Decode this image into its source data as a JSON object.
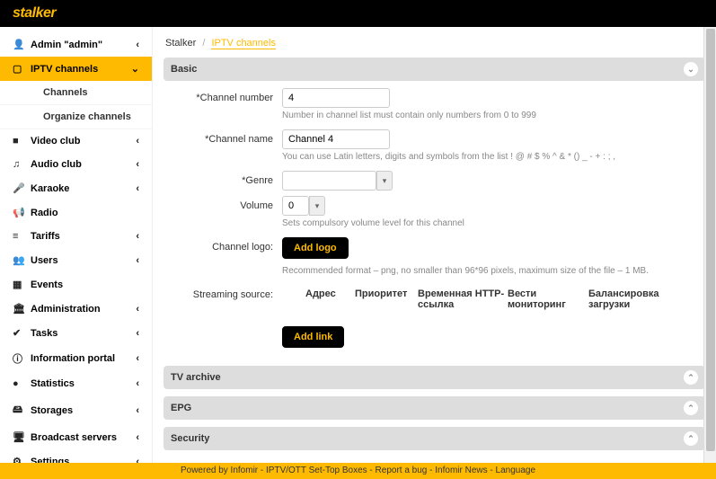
{
  "logo": "stalker",
  "breadcrumb": {
    "root": "Stalker",
    "current": "IPTV channels"
  },
  "sidebar": [
    {
      "icon": "👤",
      "label": "Admin \"admin\"",
      "chev": "‹",
      "self": true
    },
    {
      "icon": "▢",
      "label": "IPTV channels",
      "chev": "⌄",
      "active": true,
      "children": [
        {
          "label": "Channels"
        },
        {
          "label": "Organize channels"
        }
      ]
    },
    {
      "icon": "■",
      "label": "Video club",
      "chev": "‹"
    },
    {
      "icon": "♫",
      "label": "Audio club",
      "chev": "‹"
    },
    {
      "icon": "🎤",
      "label": "Karaoke",
      "chev": "‹"
    },
    {
      "icon": "📢",
      "label": "Radio",
      "chev": ""
    },
    {
      "icon": "≡",
      "label": "Tariffs",
      "chev": "‹"
    },
    {
      "icon": "👥",
      "label": "Users",
      "chev": "‹"
    },
    {
      "icon": "▦",
      "label": "Events",
      "chev": ""
    },
    {
      "icon": "🏛",
      "label": "Administration",
      "chev": "‹"
    },
    {
      "icon": "✔",
      "label": "Tasks",
      "chev": "‹"
    },
    {
      "icon": "ⓘ",
      "label": "Information portal",
      "chev": "‹"
    },
    {
      "icon": "●",
      "label": "Statistics",
      "chev": "‹"
    },
    {
      "icon": "🖴",
      "label": "Storages",
      "chev": "‹"
    },
    {
      "icon": "🖥",
      "label": "Broadcast servers",
      "chev": "‹"
    },
    {
      "icon": "⚙",
      "label": "Settings",
      "chev": "‹"
    }
  ],
  "panelTitles": {
    "basic": "Basic",
    "tv": "TV archive",
    "epg": "EPG",
    "sec": "Security"
  },
  "form": {
    "channel_number": {
      "label": "*Channel number",
      "value": "4",
      "hint": "Number in channel list must contain only numbers from 0 to 999"
    },
    "channel_name": {
      "label": "*Channel name",
      "value": "Channel 4",
      "hint": "You can use Latin letters, digits and symbols from the list ! @ # $ % ^ & * () _ - + : ; ,"
    },
    "genre": {
      "label": "*Genre",
      "value": ""
    },
    "volume": {
      "label": "Volume",
      "value": "0",
      "hint": "Sets compulsory volume level for this channel"
    },
    "logo": {
      "label": "Channel logo:",
      "button": "Add logo",
      "hint": "Recommended format – png, no smaller than 96*96 pixels, maximum size of the file – 1 MB."
    },
    "stream": {
      "label": "Streaming source:",
      "headers": [
        "Адрес",
        "Приоритет",
        "Временная HTTP-ссылка",
        "Вести мониторинг",
        "Балансировка загрузки"
      ],
      "button": "Add link"
    }
  },
  "footer": {
    "pre": "Powered by Infomir - ",
    "l1": "IPTV/OTT Set-Top Boxes",
    "sep": " - ",
    "l2": "Report a bug",
    "l3": "Infomir News",
    "l4": "Language"
  }
}
